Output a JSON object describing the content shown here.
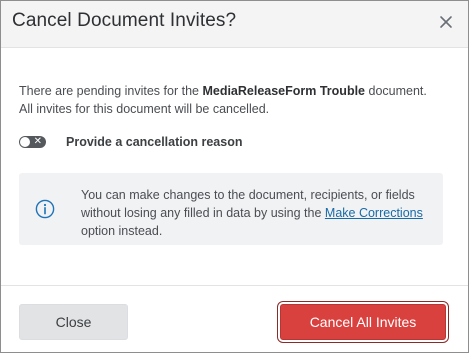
{
  "dialog": {
    "title": "Cancel Document Invites?",
    "close_icon": "close-icon"
  },
  "message": {
    "prefix": "There are pending invites for the ",
    "document_name": "MediaReleaseForm Trouble",
    "suffix": " document. All invites for this document will be cancelled."
  },
  "toggle": {
    "label": "Provide a cancellation reason",
    "state": "off",
    "off_glyph": "✕"
  },
  "info": {
    "icon": "info-icon",
    "text_before": "You can make changes to the document, recipients, or fields without losing any filled in data by using the ",
    "link_text": "Make Corrections",
    "text_after": " option instead."
  },
  "footer": {
    "close_label": "Close",
    "cancel_all_label": "Cancel All Invites"
  },
  "colors": {
    "header_bg": "#f4f4f5",
    "danger": "#d9413f",
    "link": "#1a6aa6",
    "info_bg": "#f1f2f4"
  }
}
